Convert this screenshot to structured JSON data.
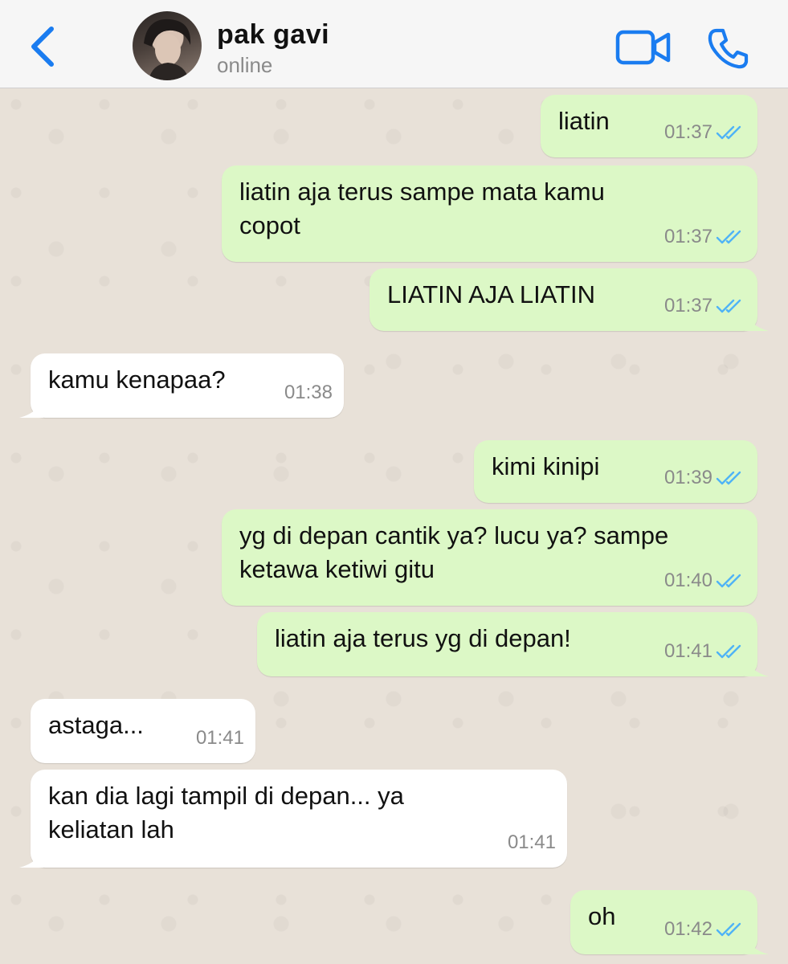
{
  "header": {
    "contact_name": "pak gavi",
    "status": "online",
    "back_icon": "chevron-left-icon",
    "video_icon": "video-camera-icon",
    "call_icon": "phone-icon",
    "accent_color": "#1a7cf0"
  },
  "messages": [
    {
      "direction": "out",
      "text": "liatin",
      "time": "01:37",
      "read": true
    },
    {
      "direction": "out",
      "text": "liatin aja terus sampe mata kamu\ncopot",
      "time": "01:37",
      "read": true
    },
    {
      "direction": "out",
      "text": "LIATIN AJA LIATIN",
      "time": "01:37",
      "read": true
    },
    {
      "direction": "in",
      "text": "kamu kenapaa?",
      "time": "01:38"
    },
    {
      "direction": "out",
      "text": "kimi kinipi",
      "time": "01:39",
      "read": true
    },
    {
      "direction": "out",
      "text": "yg di depan cantik ya? lucu ya? sampe\nketawa ketiwi gitu",
      "time": "01:40",
      "read": true
    },
    {
      "direction": "out",
      "text": "liatin aja terus yg di depan!",
      "time": "01:41",
      "read": true
    },
    {
      "direction": "in",
      "text": "astaga...",
      "time": "01:41"
    },
    {
      "direction": "in",
      "text": "kan dia lagi tampil di depan... ya\nkeliatan lah",
      "time": "01:41"
    },
    {
      "direction": "out",
      "text": "oh",
      "time": "01:42",
      "read": true
    }
  ],
  "colors": {
    "outgoing_bubble": "#dcf8c6",
    "incoming_bubble": "#ffffff",
    "read_ticks": "#4fb3f6"
  }
}
